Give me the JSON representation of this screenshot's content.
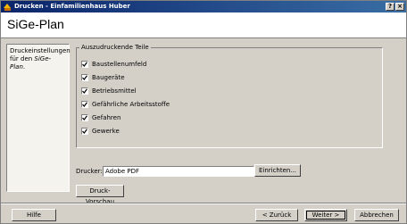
{
  "window": {
    "title": "Drucken - Einfamilienhaus Huber",
    "help_button": "?",
    "close_button": "×"
  },
  "header": {
    "title": "SiGe-Plan"
  },
  "sidebar": {
    "text_prefix": "Druckeinstellungen für den ",
    "text_emph": "SiGe-Plan",
    "text_suffix": "."
  },
  "parts": {
    "legend": "Auszudruckende Teile",
    "items": [
      {
        "label": "Baustellenumfeld",
        "checked": true
      },
      {
        "label": "Baugeräte",
        "checked": true
      },
      {
        "label": "Betriebsmittel",
        "checked": true
      },
      {
        "label": "Gefährliche Arbeitsstoffe",
        "checked": true
      },
      {
        "label": "Gefahren",
        "checked": true
      },
      {
        "label": "Gewerke",
        "checked": true
      }
    ]
  },
  "printer": {
    "label": "Drucker:",
    "value": "Adobe PDF",
    "setup_label": "Einrichten..."
  },
  "preview_label": "Druck-Vorschau",
  "footer": {
    "help": "Hilfe",
    "back": "< Zurück",
    "next": "Weiter >",
    "cancel": "Abbrechen"
  }
}
